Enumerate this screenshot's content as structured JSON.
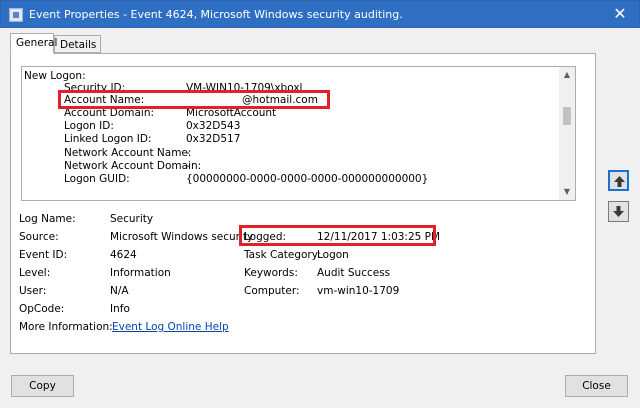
{
  "window": {
    "title": "Event Properties - Event 4624, Microsoft Windows security auditing.",
    "close_glyph": "✕"
  },
  "tabs": [
    {
      "label": "General"
    },
    {
      "label": "Details"
    }
  ],
  "description": {
    "header": "New Logon:",
    "rows": [
      {
        "key": "Security ID:",
        "value": "VM-WIN10-1709\\xboxl"
      },
      {
        "key": "Account Name:",
        "value": "@hotmail.com"
      },
      {
        "key": "Account Domain:",
        "value": "MicrosoftAccount"
      },
      {
        "key": "Logon ID:",
        "value": "0x32D543"
      },
      {
        "key": "Linked Logon ID:",
        "value": "0x32D517"
      },
      {
        "key": "Network Account Name:",
        "value": "-"
      },
      {
        "key": "Network Account Domain:",
        "value": "-"
      },
      {
        "key": "Logon GUID:",
        "value": "{00000000-0000-0000-0000-000000000000}"
      }
    ]
  },
  "details": {
    "log_name": {
      "label": "Log Name:",
      "value": "Security"
    },
    "source": {
      "label": "Source:",
      "value": "Microsoft Windows security"
    },
    "logged": {
      "label": "Logged:",
      "value": "12/11/2017 1:03:25 PM"
    },
    "event_id": {
      "label": "Event ID:",
      "value": "4624"
    },
    "task_category": {
      "label": "Task Category:",
      "value": "Logon"
    },
    "level": {
      "label": "Level:",
      "value": "Information"
    },
    "keywords": {
      "label": "Keywords:",
      "value": "Audit Success"
    },
    "user": {
      "label": "User:",
      "value": "N/A"
    },
    "computer": {
      "label": "Computer:",
      "value": "vm-win10-1709"
    },
    "opcode": {
      "label": "OpCode:",
      "value": "Info"
    },
    "more_info": {
      "label": "More Information:",
      "link": "Event Log Online Help"
    }
  },
  "buttons": {
    "copy": "Copy",
    "close": "Close"
  },
  "colors": {
    "titlebar": "#2e6fc4",
    "highlight": "#e0202a",
    "link": "#0645ad"
  }
}
